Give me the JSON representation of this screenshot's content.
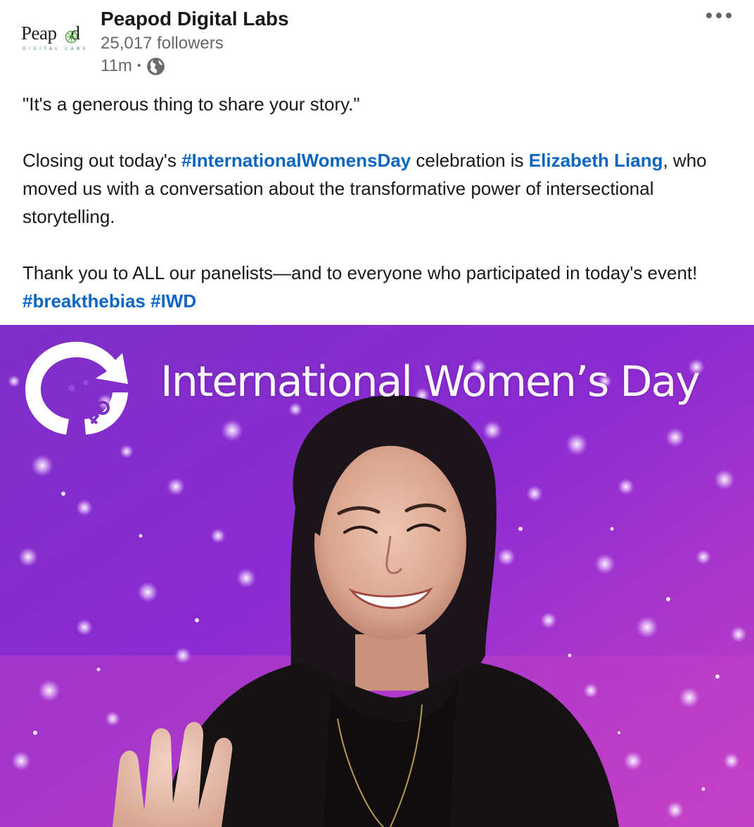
{
  "post": {
    "company_name": "Peapod Digital Labs",
    "followers": "25,017 followers",
    "time": "11m",
    "separator": "•",
    "logo": {
      "word_left": "Peap",
      "word_right": "d",
      "subtitle": "DIGITAL LABS"
    },
    "text": {
      "quote": "\"It's a generous thing to share your story.\"",
      "p2_part1": "Closing out today's ",
      "p2_hashtag": "#InternationalWomensDay",
      "p2_part2": " celebration is ",
      "p2_mention": "Elizabeth Liang",
      "p2_part3": ", who moved us with a conversation about the transformative power of intersectional storytelling.",
      "p3_part1": "Thank you to ALL our panelists—and to everyone who participated in today's event! ",
      "p3_hashtag1": "#breakthebias",
      "p3_space": " ",
      "p3_hashtag2": "#IWD"
    },
    "image": {
      "banner_text": "International Women’s Day"
    }
  },
  "icons": {
    "globe": "globe-icon",
    "more": "ellipsis-icon",
    "leaf": "leaf-icon",
    "iwd_logo": "iwd-symbol-icon"
  },
  "colors": {
    "link": "#0a66c2",
    "background_purple": "#8a2bd0",
    "background_magenta": "#c13fc8"
  }
}
